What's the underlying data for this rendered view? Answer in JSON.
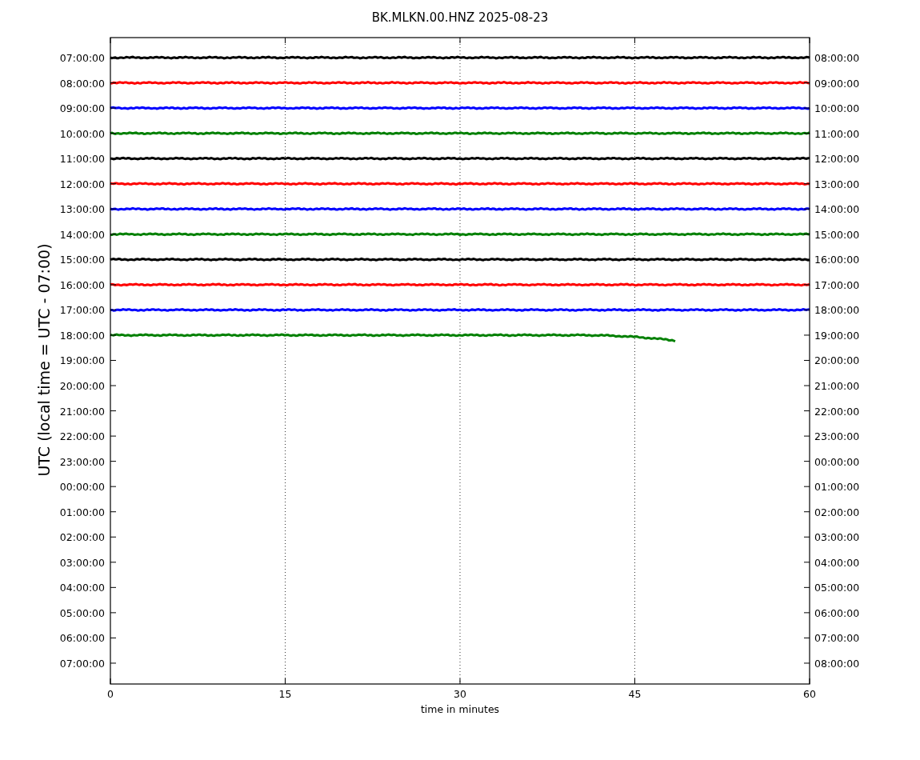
{
  "plot": {
    "title": "BK.MLKN.00.HNZ 2025-08-23",
    "xlabel": "time in minutes",
    "ylabel": "UTC (local time = UTC - 07:00)",
    "x_tick_labels": [
      "0",
      "15",
      "30",
      "45",
      "60"
    ]
  },
  "left_labels": [
    "07:00:00",
    "08:00:00",
    "09:00:00",
    "10:00:00",
    "11:00:00",
    "12:00:00",
    "13:00:00",
    "14:00:00",
    "15:00:00",
    "16:00:00",
    "17:00:00",
    "18:00:00",
    "19:00:00",
    "20:00:00",
    "21:00:00",
    "22:00:00",
    "23:00:00",
    "00:00:00",
    "01:00:00",
    "02:00:00",
    "03:00:00",
    "04:00:00",
    "05:00:00",
    "06:00:00",
    "07:00:00"
  ],
  "right_labels": [
    "08:00:00",
    "09:00:00",
    "10:00:00",
    "11:00:00",
    "12:00:00",
    "13:00:00",
    "14:00:00",
    "15:00:00",
    "16:00:00",
    "17:00:00",
    "18:00:00",
    "19:00:00",
    "20:00:00",
    "21:00:00",
    "22:00:00",
    "23:00:00",
    "00:00:00",
    "01:00:00",
    "02:00:00",
    "03:00:00",
    "04:00:00",
    "05:00:00",
    "06:00:00",
    "07:00:00",
    "08:00:00"
  ],
  "traces": [
    {
      "color": "#000000",
      "level": 1
    },
    {
      "color": "#ff0000",
      "level": 1
    },
    {
      "color": "#0000ff",
      "level": 1
    },
    {
      "color": "#008000",
      "level": 1
    },
    {
      "color": "#000000",
      "level": 1
    },
    {
      "color": "#ff0000",
      "level": 1
    },
    {
      "color": "#0000ff",
      "level": 1
    },
    {
      "color": "#008000",
      "level": 1
    },
    {
      "color": "#000000",
      "level": 1
    },
    {
      "color": "#ff0000",
      "level": 1
    },
    {
      "color": "#0000ff",
      "level": 1
    },
    {
      "color": "#008000",
      "level": 0.81
    }
  ]
}
